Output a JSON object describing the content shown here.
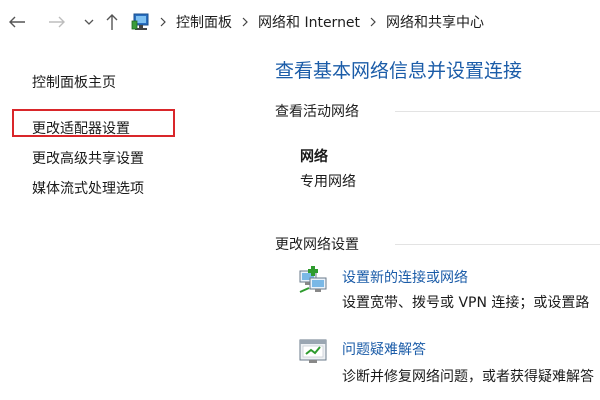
{
  "address_bar": {
    "crumbs": [
      "控制面板",
      "网络和 Internet",
      "网络和共享中心"
    ]
  },
  "left_pane": {
    "items": [
      {
        "label": "控制面板主页"
      },
      {
        "label": "更改适配器设置"
      },
      {
        "label": "更改高级共享设置"
      },
      {
        "label": "媒体流式处理选项"
      }
    ]
  },
  "main": {
    "title": "查看基本网络信息并设置连接",
    "active_networks": {
      "heading": "查看活动网络",
      "network_name": "网络",
      "network_type": "专用网络"
    },
    "change_settings": {
      "heading": "更改网络设置",
      "tasks": [
        {
          "label": "设置新的连接或网络",
          "description": "设置宽带、拨号或 VPN 连接；或设置路",
          "icon": "network-connection-icon"
        },
        {
          "label": "问题疑难解答",
          "description": "诊断并修复网络问题，或者获得疑难解答",
          "icon": "troubleshoot-icon"
        }
      ]
    }
  },
  "colors": {
    "link_blue": "#1b5ca8",
    "highlight_red": "#d9262a"
  }
}
